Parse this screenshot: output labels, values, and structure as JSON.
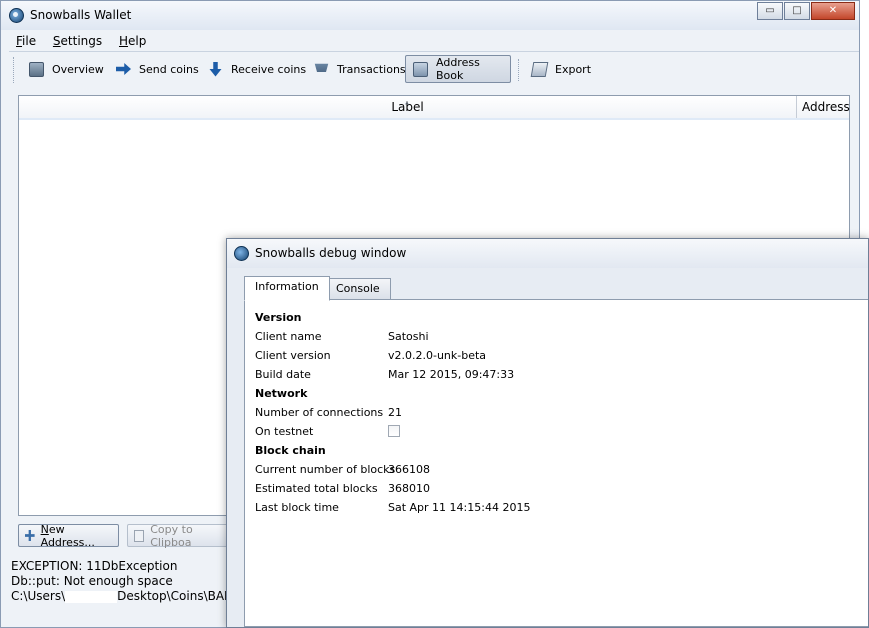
{
  "main_window": {
    "title": "Snowballs Wallet",
    "window_buttons": {
      "minimize": "▭",
      "maximize": "□",
      "close": "✕"
    },
    "menu": [
      {
        "underlined": "F",
        "rest": "ile"
      },
      {
        "underlined": "S",
        "rest": "ettings"
      },
      {
        "underlined": "H",
        "rest": "elp"
      }
    ],
    "toolbar": {
      "overview": "Overview",
      "send": "Send coins",
      "receive": "Receive coins",
      "transactions": "Transactions",
      "address_book": "Address Book",
      "export": "Export"
    },
    "table": {
      "columns": [
        "Label",
        "Address"
      ],
      "sort_indicator": "^"
    },
    "buttons": {
      "new_address_underlined": "N",
      "new_address_rest": "ew Address...",
      "copy": "Copy to Clipboa"
    },
    "status_lines": {
      "line1": "EXCEPTION: 11DbException",
      "line2": "Db::put: Not enough space",
      "line3_prefix": "C:\\Users\\",
      "line3_suffix": "Desktop\\Coins\\BALLS"
    }
  },
  "debug_window": {
    "title": "Snowballs debug window",
    "tabs": [
      "Information",
      "Console"
    ],
    "sections": {
      "version": "Version",
      "network": "Network",
      "block_chain": "Block chain"
    },
    "fields": {
      "client_name": {
        "label": "Client name",
        "value": "Satoshi"
      },
      "client_version": {
        "label": "Client version",
        "value": "v2.0.2.0-unk-beta"
      },
      "build_date": {
        "label": "Build date",
        "value": "Mar 12 2015, 09:47:33"
      },
      "connections": {
        "label": "Number of connections",
        "value": "21"
      },
      "testnet": {
        "label": "On testnet",
        "checked": false
      },
      "current_blocks": {
        "label": "Current number of blocks",
        "value": "366108"
      },
      "estimated_blocks": {
        "label": "Estimated total blocks",
        "value": "368010"
      },
      "last_block_time": {
        "label": "Last block time",
        "value": "Sat Apr 11 14:15:44 2015"
      }
    }
  }
}
